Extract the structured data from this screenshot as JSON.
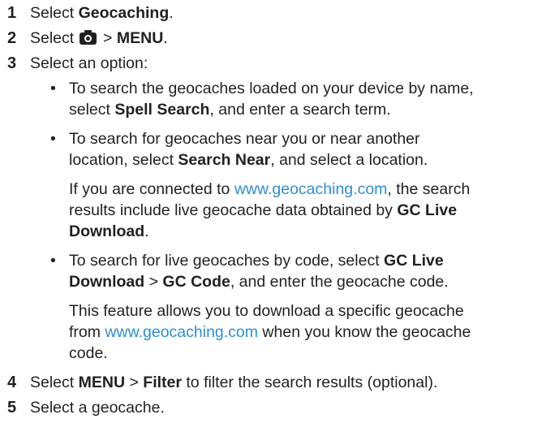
{
  "steps": [
    {
      "num": "1",
      "pre": "Select ",
      "bold": "Geocaching",
      "post": "."
    },
    {
      "num": "2",
      "pre": "Select ",
      "sep": " > ",
      "bold": "MENU",
      "post": ".",
      "icon": "camera-icon"
    },
    {
      "num": "3",
      "text": "Select an option:"
    },
    {
      "num": "4",
      "pre": "Select ",
      "bold1": "MENU",
      "sep": " > ",
      "bold2": "Filter",
      "post": " to filter the search results (optional)."
    },
    {
      "num": "5",
      "text": "Select a geocache."
    }
  ],
  "options": [
    {
      "line1": "To search the geocaches loaded on your device by name,",
      "line2_pre": "select ",
      "line2_bold": "Spell Search",
      "line2_post": ", and enter a search term."
    },
    {
      "line1": "To search for geocaches near you or near another",
      "line2_pre": "location, select ",
      "line2_bold": "Search Near",
      "line2_post": ", and select a location.",
      "note_line1_pre": "If you are connected to ",
      "note_link": "www.geocaching.com",
      "note_line1_post": ", the search",
      "note_line2_pre": "results include live geocache data obtained by ",
      "note_line2_bold": "GC Live",
      "note_line3_bold": "Download",
      "note_line3_post": "."
    },
    {
      "line1_pre": "To search for live geocaches by code, select ",
      "line1_bold": "GC Live",
      "line2_bold1": "Download",
      "line2_sep": " > ",
      "line2_bold2": "GC Code",
      "line2_post": ", and enter the geocache code.",
      "note_line1": "This feature allows you to download a specific geocache",
      "note_line2_pre": "from ",
      "note_link": "www.geocaching.com",
      "note_line2_post": " when you know the geocache",
      "note_line3": "code."
    }
  ],
  "bullet_char": "•",
  "colors": {
    "text": "#231f20",
    "link": "#2e8ed0"
  }
}
